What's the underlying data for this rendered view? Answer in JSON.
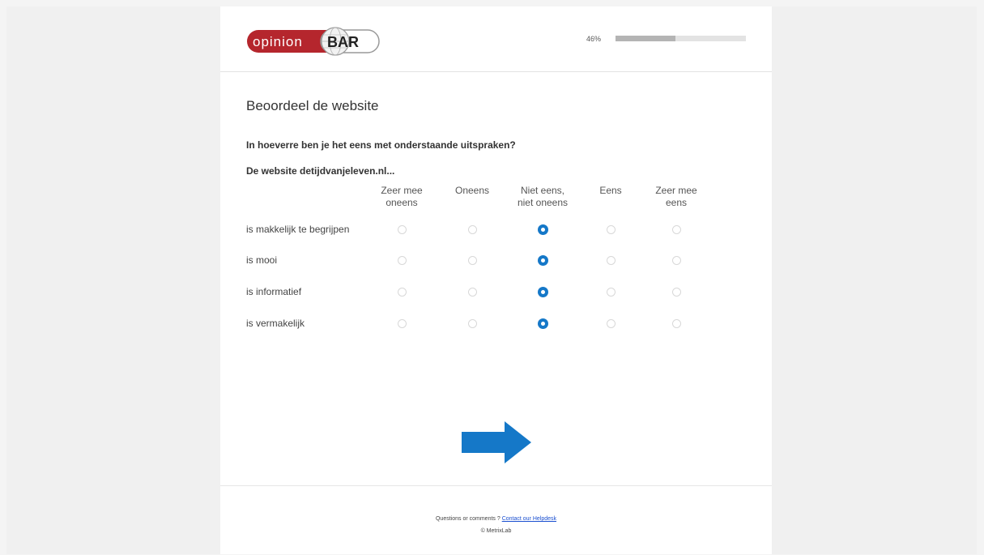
{
  "header": {
    "logo_text_left": "opinion",
    "logo_text_right": "BAR",
    "progress_label": "46%",
    "progress_fraction": 0.46
  },
  "main": {
    "title": "Beoordeel de website",
    "question": "In hoeverre ben je het eens met onderstaande uitspraken?",
    "subquestion": "De website detijdvanjeleven.nl...",
    "columns": [
      {
        "line1": "Zeer mee",
        "line2": "oneens"
      },
      {
        "line1": "Oneens",
        "line2": ""
      },
      {
        "line1": "Niet eens,",
        "line2": "niet oneens"
      },
      {
        "line1": "Eens",
        "line2": ""
      },
      {
        "line1": "Zeer mee",
        "line2": "eens"
      }
    ],
    "rows": [
      {
        "label": "is makkelijk te begrijpen",
        "selected": 2
      },
      {
        "label": "is mooi",
        "selected": 2
      },
      {
        "label": "is informatief",
        "selected": 2
      },
      {
        "label": "is vermakelijk",
        "selected": 2
      }
    ],
    "next_icon": "arrow-right-icon"
  },
  "footer": {
    "prefix": "Questions or comments ? ",
    "link_text": "Contact our Helpdesk",
    "copyright": "© MetrixLab"
  },
  "colors": {
    "accent": "#1578c8",
    "logo_red": "#b5262d",
    "progress_fill": "#b4b4b4"
  }
}
